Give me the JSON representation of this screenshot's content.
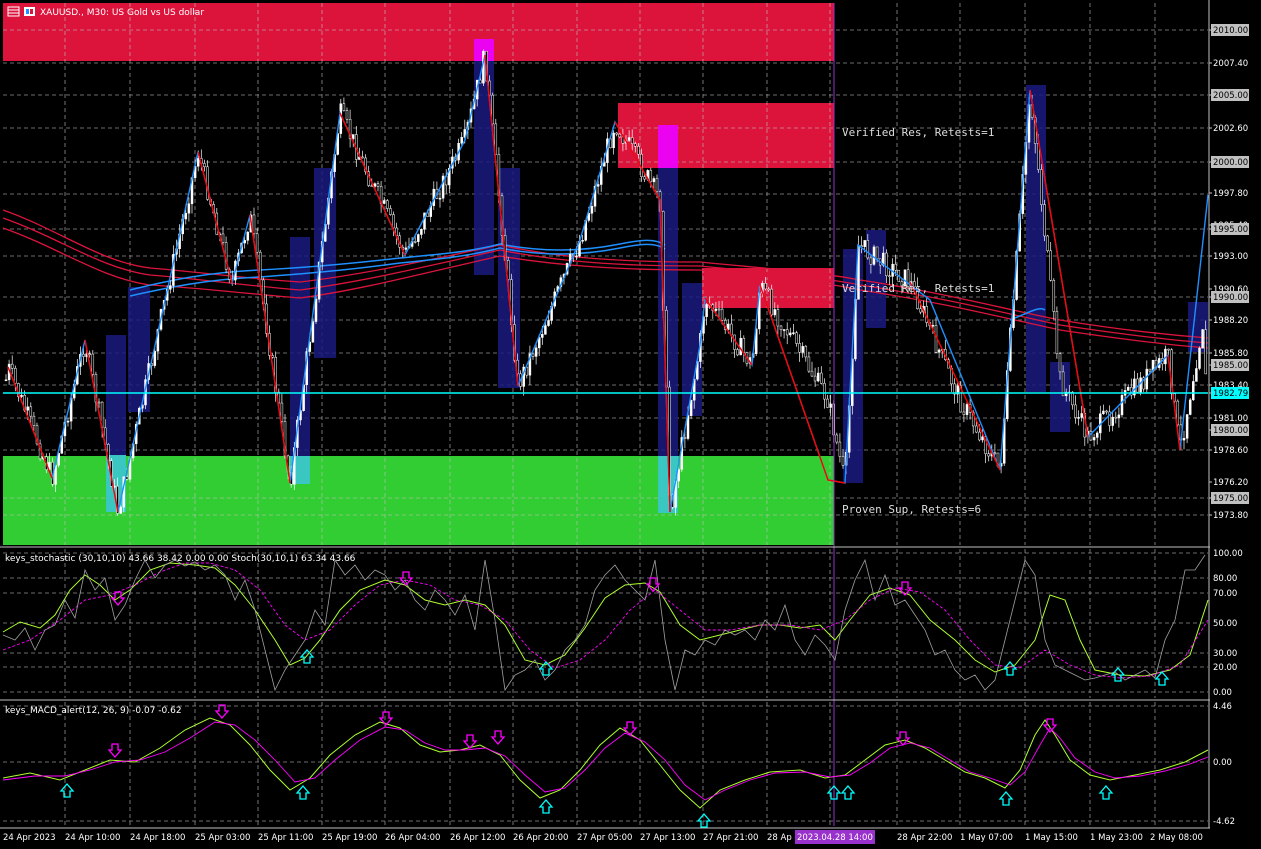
{
  "window": {
    "title": "XAUUSD., M30: US Gold vs US dollar"
  },
  "zones": [
    {
      "label": ""
    },
    {
      "label": "Verified Res, Retests=1"
    },
    {
      "label": "Verified Res, Retests=1"
    },
    {
      "label": "Proven Sup, Retests=6"
    }
  ],
  "price_axis": {
    "labels": [
      "2010.00",
      "2007.40",
      "2005.00",
      "2002.60",
      "2000.00",
      "1997.80",
      "1995.40",
      "1995.00",
      "1993.00",
      "1990.60",
      "1990.00",
      "1988.20",
      "1985.80",
      "1985.00",
      "1983.40",
      "1982.79",
      "1981.00",
      "1980.00",
      "1978.60",
      "1976.20",
      "1975.00",
      "1973.80"
    ],
    "boxed": [
      "2010.00",
      "2005.00",
      "2000.00",
      "1995.00",
      "1990.00",
      "1985.00",
      "1980.00",
      "1975.00"
    ],
    "current_price": "1982.79"
  },
  "stoch": {
    "header": "keys_stochastic (30,10,10) 43.66 38.42 0.00 0.00 Stoch(30,10,1) 63.34 43.66",
    "levels": [
      "100.00",
      "80.00",
      "70.00",
      "50.00",
      "30.00",
      "20.00",
      "0.00"
    ]
  },
  "macd": {
    "header": "keys_MACD_alert(12, 26, 9) -0.07 -0.62",
    "levels": [
      "4.46",
      "0.00",
      "-4.62"
    ]
  },
  "time_axis": {
    "labels": [
      "24 Apr 2023",
      "24 Apr 10:00",
      "24 Apr 18:00",
      "25 Apr 03:00",
      "25 Apr 11:00",
      "25 Apr 19:00",
      "26 Apr 04:00",
      "26 Apr 12:00",
      "26 Apr 20:00",
      "27 Apr 05:00",
      "27 Apr 13:00",
      "27 Apr 21:00",
      "28 Ap",
      "28 Apr 22:00",
      "1 May 07:00",
      "1 May 15:00",
      "1 May 23:00",
      "2 May 08:00"
    ],
    "cursor": "2023.04.28 14:00"
  },
  "colors": {
    "resistance": "#dc143c",
    "support": "#32cd32",
    "zigzag_up": "#1e90ff",
    "zigzag_down": "#ff0000",
    "ma_red": "#dc143c",
    "ma_blue": "#1e90ff",
    "price_line": "#00ffff",
    "cursor": "#9932cc",
    "stoch_fast": "#c8c8c8",
    "stoch_signal": "#ff00ff",
    "macd_main": "#adff2f",
    "macd_signal": "#ff00ff",
    "arrow_up": "#00ffff",
    "arrow_down": "#ff00ff"
  },
  "icons": {
    "app_icon": "bar-chart-icon",
    "symbol_icon": "chart-window-icon"
  }
}
